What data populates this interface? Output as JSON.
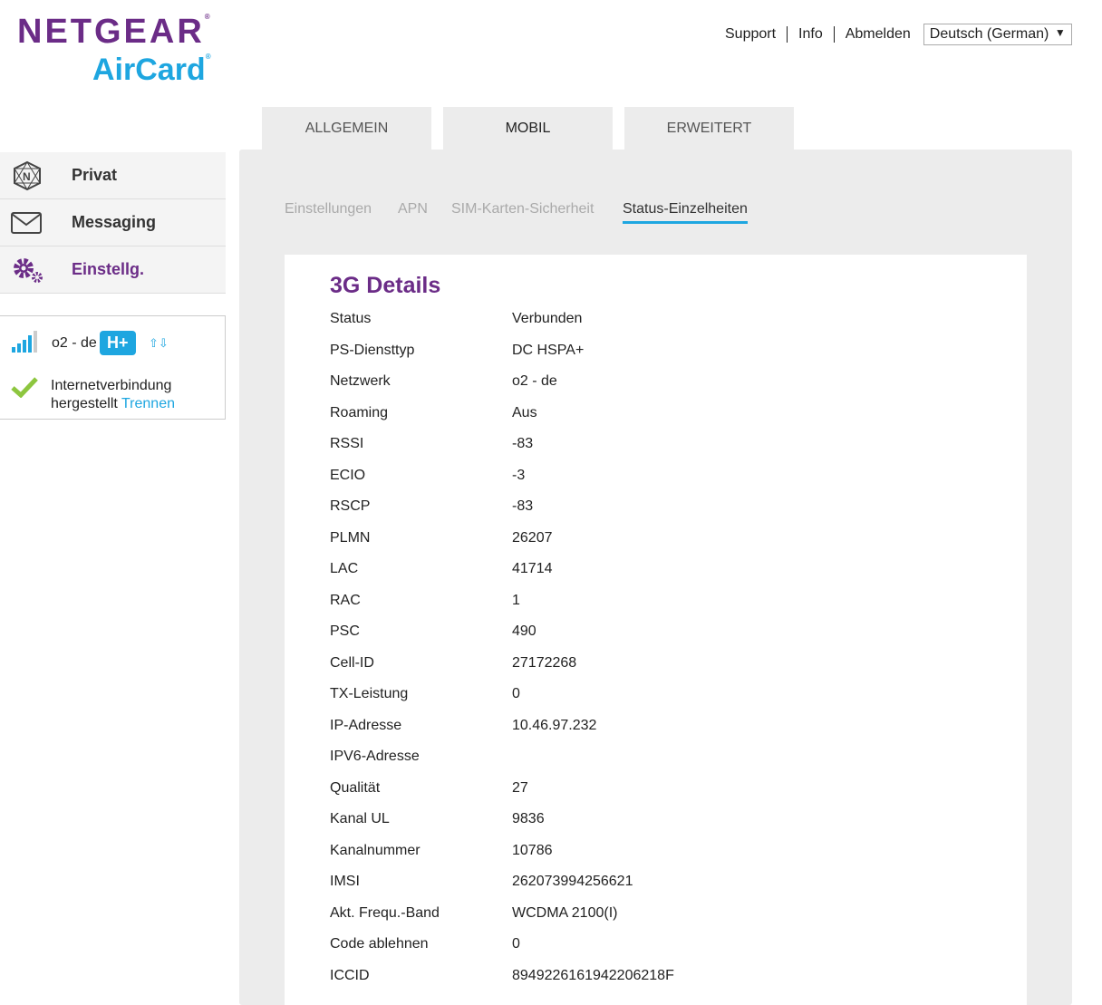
{
  "logo": {
    "brand": "NETGEAR",
    "product": "AirCard"
  },
  "header": {
    "links": [
      "Support",
      "Info",
      "Abmelden"
    ],
    "language": "Deutsch (German)"
  },
  "tabs": [
    "ALLGEMEIN",
    "MOBIL",
    "ERWEITERT"
  ],
  "sidebar": {
    "items": [
      {
        "label": "Privat",
        "icon": "netgear-icon"
      },
      {
        "label": "Messaging",
        "icon": "envelope-icon"
      },
      {
        "label": "Einstellg.",
        "icon": "gears-icon"
      }
    ]
  },
  "status": {
    "network": "o2 - de",
    "badge": "H+",
    "connection": "Internetverbindung hergestellt",
    "disconnect": "Trennen"
  },
  "subtabs": [
    "Einstellungen",
    "APN",
    "SIM-Karten-Sicherheit",
    "Status-Einzelheiten"
  ],
  "details": {
    "title": "3G Details",
    "rows": [
      [
        "Status",
        "Verbunden"
      ],
      [
        "PS-Diensttyp",
        "DC HSPA+"
      ],
      [
        "Netzwerk",
        "o2 - de"
      ],
      [
        "Roaming",
        "Aus"
      ],
      [
        "RSSI",
        "-83"
      ],
      [
        "ECIO",
        "-3"
      ],
      [
        "RSCP",
        "-83"
      ],
      [
        "PLMN",
        "26207"
      ],
      [
        "LAC",
        "41714"
      ],
      [
        "RAC",
        "1"
      ],
      [
        "PSC",
        "490"
      ],
      [
        "Cell-ID",
        "27172268"
      ],
      [
        "TX-Leistung",
        "0"
      ],
      [
        "IP-Adresse",
        "10.46.97.232"
      ],
      [
        "IPV6-Adresse",
        ""
      ],
      [
        "Qualität",
        "27"
      ],
      [
        "Kanal UL",
        "9836"
      ],
      [
        "Kanalnummer",
        "10786"
      ],
      [
        "IMSI",
        "262073994256621"
      ],
      [
        "Akt. Frequ.-Band",
        "WCDMA 2100(I)"
      ],
      [
        "Code ablehnen",
        "0"
      ],
      [
        "ICCID",
        "8949226161942206218F"
      ]
    ]
  },
  "colors": {
    "purple": "#6b2c87",
    "blue": "#1ea6e0",
    "green": "#8dc63f"
  }
}
